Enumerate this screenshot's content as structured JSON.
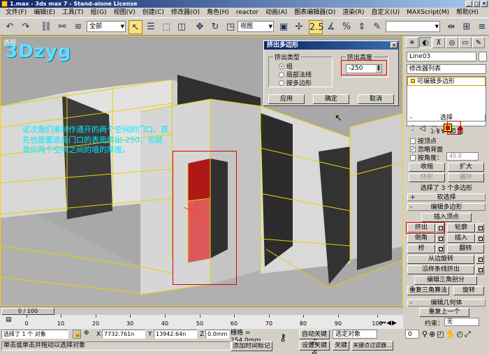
{
  "window": {
    "title": "1.max - 3ds max 7  - Stand-alone License"
  },
  "menu": [
    "文件(F)",
    "编辑(E)",
    "工具(T)",
    "组(G)",
    "视图(V)",
    "创建(C)",
    "修改器(O)",
    "角色(H)",
    "reactor",
    "动画(A)",
    "图表编辑器(D)",
    "渲染(R)",
    "自定义(U)",
    "MAXScript(M)",
    "帮助(H)"
  ],
  "toolbar": {
    "selection_filter": "全部",
    "ref_coord": "视图"
  },
  "viewport": {
    "label": "透视",
    "brand": "3Dzyg",
    "instruction": "这次我们来制作通开的两个空间的门口，首先也是要选择门口的表面挤出-250，也就是你两个空间之间的墙的厚度。"
  },
  "dialog": {
    "title": "挤出多边形",
    "group_label": "挤出类型",
    "options": [
      "组",
      "局部法线",
      "按多边形"
    ],
    "selected_option": "组",
    "height_label": "挤出高度",
    "height_value": "-250",
    "buttons": [
      "应用",
      "确定",
      "取消"
    ]
  },
  "command_panel": {
    "object_name": "Line03",
    "modifier_list": "修改器列表",
    "stack_item": "可编辑多边形",
    "selection": {
      "header": "选择",
      "by_vertex": "按顶点",
      "ignore_backface": "忽略背面",
      "by_angle": "按角度：",
      "angle_value": "45.0",
      "shrink": "收缩",
      "grow": "扩大",
      "ring": "环形",
      "loop": "循环",
      "status": "选择了 3 个多边形"
    },
    "soft_selection": "软选择",
    "edit_polygons": {
      "header": "编辑多边形",
      "insert_vertex": "插入顶点",
      "extrude": "挤出",
      "outline": "轮廓",
      "bevel": "倒角",
      "inset": "插入",
      "bridge": "桥",
      "flip": "翻转",
      "hinge": "从边旋转",
      "extrude_along_spline": "沿样条线挤出",
      "edit_tri": "编辑三角剖分",
      "retriangulate": "重复三角算法",
      "turn": "旋转"
    },
    "edit_geometry": {
      "header": "编辑几何体",
      "repeat_last": "重复上一个",
      "constraint_label": "约束：",
      "constraint_value": "无"
    }
  },
  "timeline": {
    "frame": "0 / 100",
    "ticks": [
      "0",
      "10",
      "20",
      "30",
      "40",
      "50",
      "60",
      "70",
      "80",
      "90",
      "100"
    ]
  },
  "status": {
    "selected": "选择了 1 个 对象",
    "prompt": "单击或单击并拖动以选择对象",
    "x_label": "X",
    "x_value": "7732.761n",
    "y_label": "Y",
    "y_value": "13942.64n",
    "z_label": "Z",
    "z_value": "0.0mm",
    "grid": "栅格 = 254.0mm",
    "add_time_tag": "添加时间标记",
    "auto_key": "自动关键点",
    "set_key": "设置关键点",
    "selected_obj": "选定对象",
    "key_filters": "关键点过滤器...",
    "keys_label": "关键",
    "frame_value": "0"
  },
  "colors": {
    "accent_yellow": "#fcd000",
    "highlight_red": "#e00000",
    "text_cyan": "#00e8ff"
  }
}
